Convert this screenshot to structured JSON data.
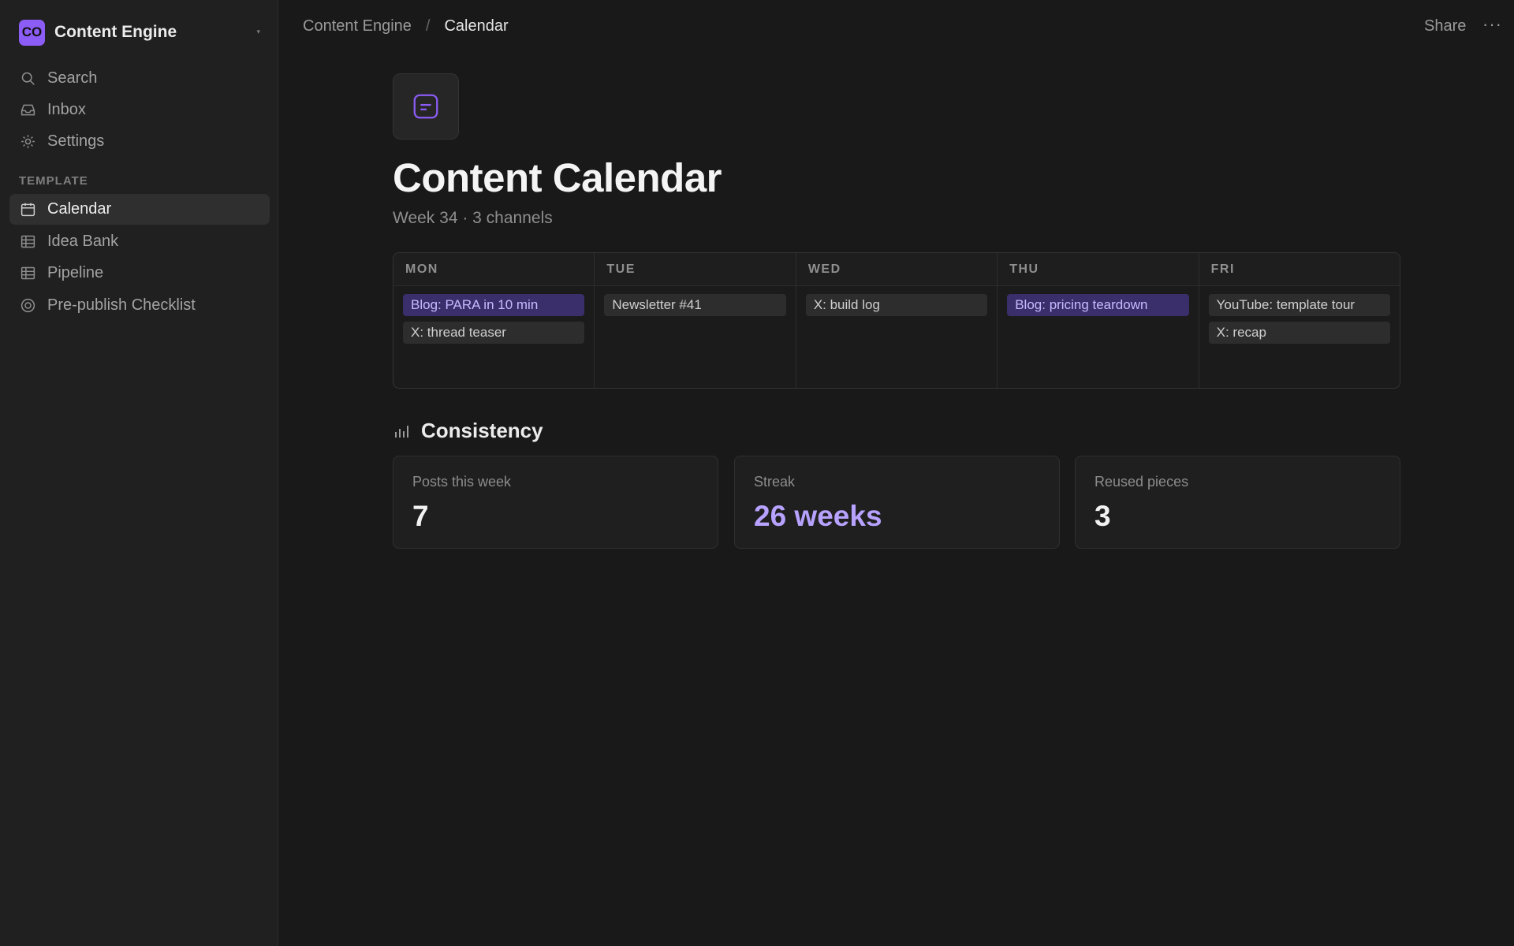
{
  "workspace": {
    "logo_text": "CO",
    "name": "Content Engine"
  },
  "sidebar": {
    "top_items": [
      {
        "label": "Search",
        "icon": "search-icon"
      },
      {
        "label": "Inbox",
        "icon": "inbox-icon"
      },
      {
        "label": "Settings",
        "icon": "gear-icon"
      }
    ],
    "section_label": "TEMPLATE",
    "items": [
      {
        "label": "Calendar",
        "icon": "calendar-icon",
        "active": true
      },
      {
        "label": "Idea Bank",
        "icon": "table-icon"
      },
      {
        "label": "Pipeline",
        "icon": "table-icon"
      },
      {
        "label": "Pre-publish Checklist",
        "icon": "target-icon"
      }
    ]
  },
  "breadcrumb": {
    "root": "Content Engine",
    "separator": "/",
    "current": "Calendar"
  },
  "topbar": {
    "share_label": "Share",
    "more_label": "···"
  },
  "page": {
    "icon": "document-icon",
    "title": "Content Calendar",
    "subtitle": "Week 34 · 3 channels"
  },
  "calendar": {
    "days": [
      {
        "name": "MON",
        "items": [
          {
            "text": "Blog: PARA in 10 min",
            "accent": true
          },
          {
            "text": "X: thread teaser",
            "accent": false
          }
        ]
      },
      {
        "name": "TUE",
        "items": [
          {
            "text": "Newsletter #41",
            "accent": false
          }
        ]
      },
      {
        "name": "WED",
        "items": [
          {
            "text": "X: build log",
            "accent": false
          }
        ]
      },
      {
        "name": "THU",
        "items": [
          {
            "text": "Blog: pricing teardown",
            "accent": true
          }
        ]
      },
      {
        "name": "FRI",
        "items": [
          {
            "text": "YouTube: template tour",
            "accent": false
          },
          {
            "text": "X: recap",
            "accent": false
          }
        ]
      }
    ]
  },
  "consistency": {
    "title": "Consistency",
    "icon": "bar-chart-icon",
    "stats": [
      {
        "label": "Posts this week",
        "value": "7"
      },
      {
        "label": "Streak",
        "value": "26 weeks"
      },
      {
        "label": "Reused pieces",
        "value": "3"
      }
    ]
  },
  "colors": {
    "accent": "#8b5cf6",
    "accent_text": "#b7a2ff",
    "background": "#191919",
    "sidebar": "#202020"
  }
}
